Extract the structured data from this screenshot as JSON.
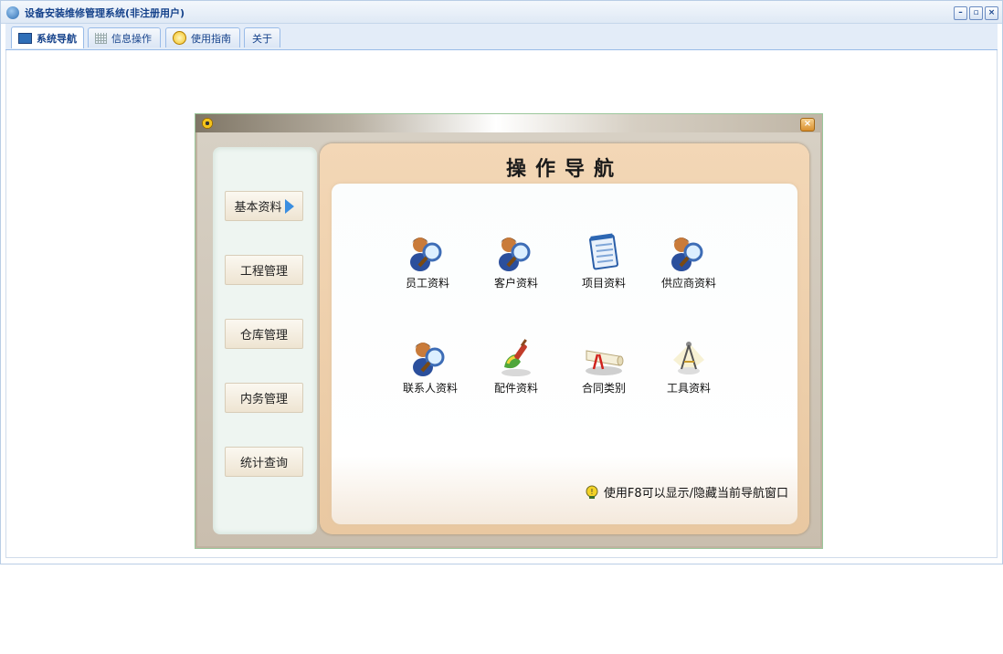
{
  "window": {
    "title": "设备安装维修管理系统(非注册用户)",
    "buttons": [
      "minimize-button",
      "restore-button",
      "close-button"
    ]
  },
  "tabs": [
    {
      "label": "系统导航",
      "icon": "monitor-icon",
      "active": true
    },
    {
      "label": "信息操作",
      "icon": "grid-icon",
      "active": false
    },
    {
      "label": "使用指南",
      "icon": "help-icon",
      "active": false
    },
    {
      "label": "关于",
      "icon": "",
      "active": false
    }
  ],
  "dialog": {
    "title_icon": "app-badge-icon",
    "sidebar": [
      {
        "label": "基本资料",
        "selected": true
      },
      {
        "label": "工程管理"
      },
      {
        "label": "仓库管理"
      },
      {
        "label": "内务管理"
      },
      {
        "label": "统计查询"
      }
    ],
    "panel_title": "操作导航",
    "items": [
      {
        "label": "员工资料",
        "icon": "person-search-icon"
      },
      {
        "label": "客户资料",
        "icon": "person-search-icon"
      },
      {
        "label": "项目资料",
        "icon": "notepad-icon"
      },
      {
        "label": "供应商资料",
        "icon": "person-search-icon"
      },
      {
        "label": "联系人资料",
        "icon": "person-search-icon"
      },
      {
        "label": "配件资料",
        "icon": "paint-brush-icon"
      },
      {
        "label": "合同类别",
        "icon": "diploma-scroll-icon"
      },
      {
        "label": "工具资料",
        "icon": "compass-tool-icon"
      }
    ],
    "tip": "使用F8可以显示/隐藏当前导航窗口"
  }
}
